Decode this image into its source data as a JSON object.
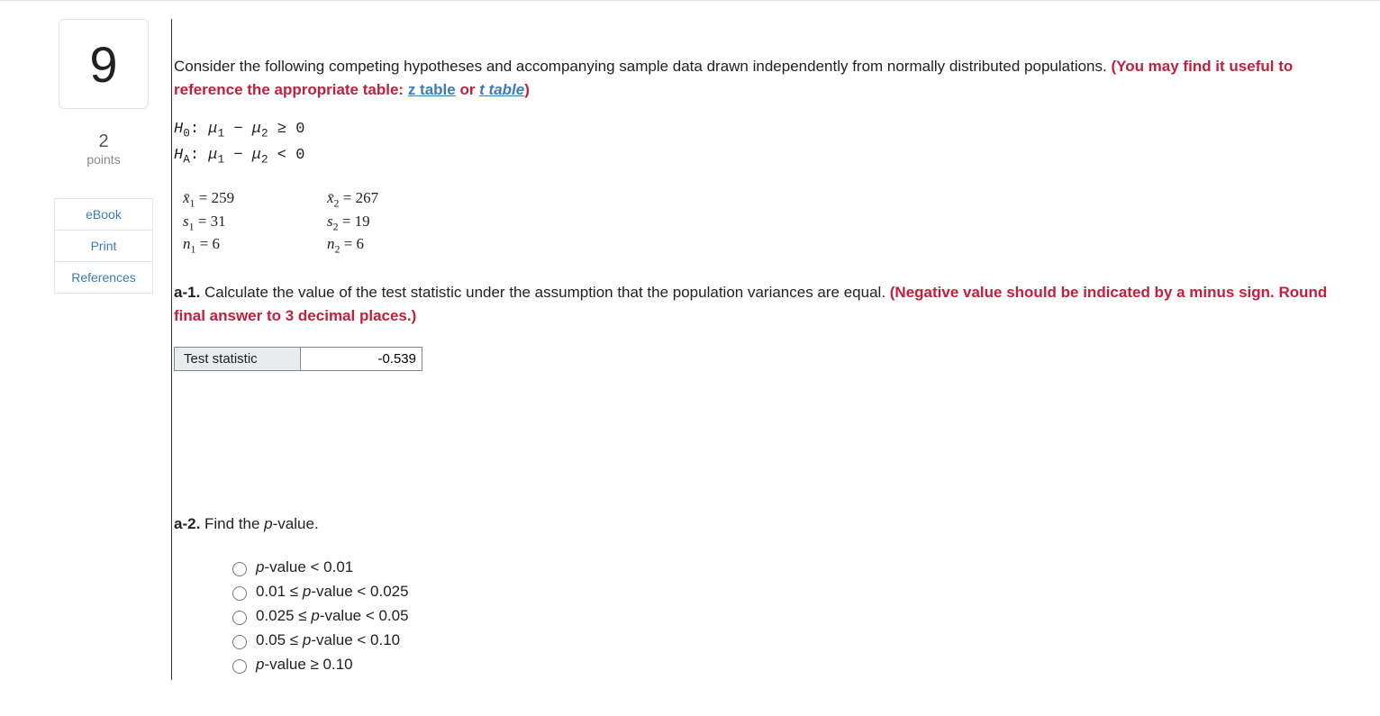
{
  "sidebar": {
    "question_number": "9",
    "points_num": "2",
    "points_label": "points",
    "ebook": "eBook",
    "print": "Print",
    "references": "References"
  },
  "intro": {
    "text1": "Consider the following competing hypotheses and accompanying sample data drawn independently from normally distributed populations. ",
    "hint_open": "(You may find it useful to reference the appropriate table: ",
    "ztable": "z table",
    "or": " or ",
    "ttable": "t table",
    "hint_close": ")"
  },
  "hypotheses": {
    "h0_label": "H",
    "h0_sub": "0",
    "h0_rest": ": μ1 − μ2 ≥ 0",
    "ha_label": "H",
    "ha_sub": "A",
    "ha_rest": ": μ1 − μ2 < 0"
  },
  "stats": {
    "x1": "259",
    "s1": "31",
    "n1": "6",
    "x2": "267",
    "s2": "19",
    "n2": "6"
  },
  "a1": {
    "label": "a-1.",
    "text": " Calculate the value of the test statistic under the assumption that the population variances are equal. ",
    "hint": "(Negative value should be indicated by a minus sign. Round final answer to 3 decimal places.)"
  },
  "answer": {
    "label": "Test statistic",
    "value": "-0.539"
  },
  "a2": {
    "label": "a-2.",
    "text_prefix": " Find the ",
    "pval": "p",
    "text_suffix": "-value."
  },
  "options": [
    {
      "pre": "",
      "p": "p",
      "post": "-value < 0.01"
    },
    {
      "pre": "0.01 ≤ ",
      "p": "p",
      "post": "-value < 0.025"
    },
    {
      "pre": "0.025 ≤ ",
      "p": "p",
      "post": "-value < 0.05"
    },
    {
      "pre": "0.05 ≤ ",
      "p": "p",
      "post": "-value < 0.10"
    },
    {
      "pre": "",
      "p": "p",
      "post": "-value ≥ 0.10"
    }
  ]
}
